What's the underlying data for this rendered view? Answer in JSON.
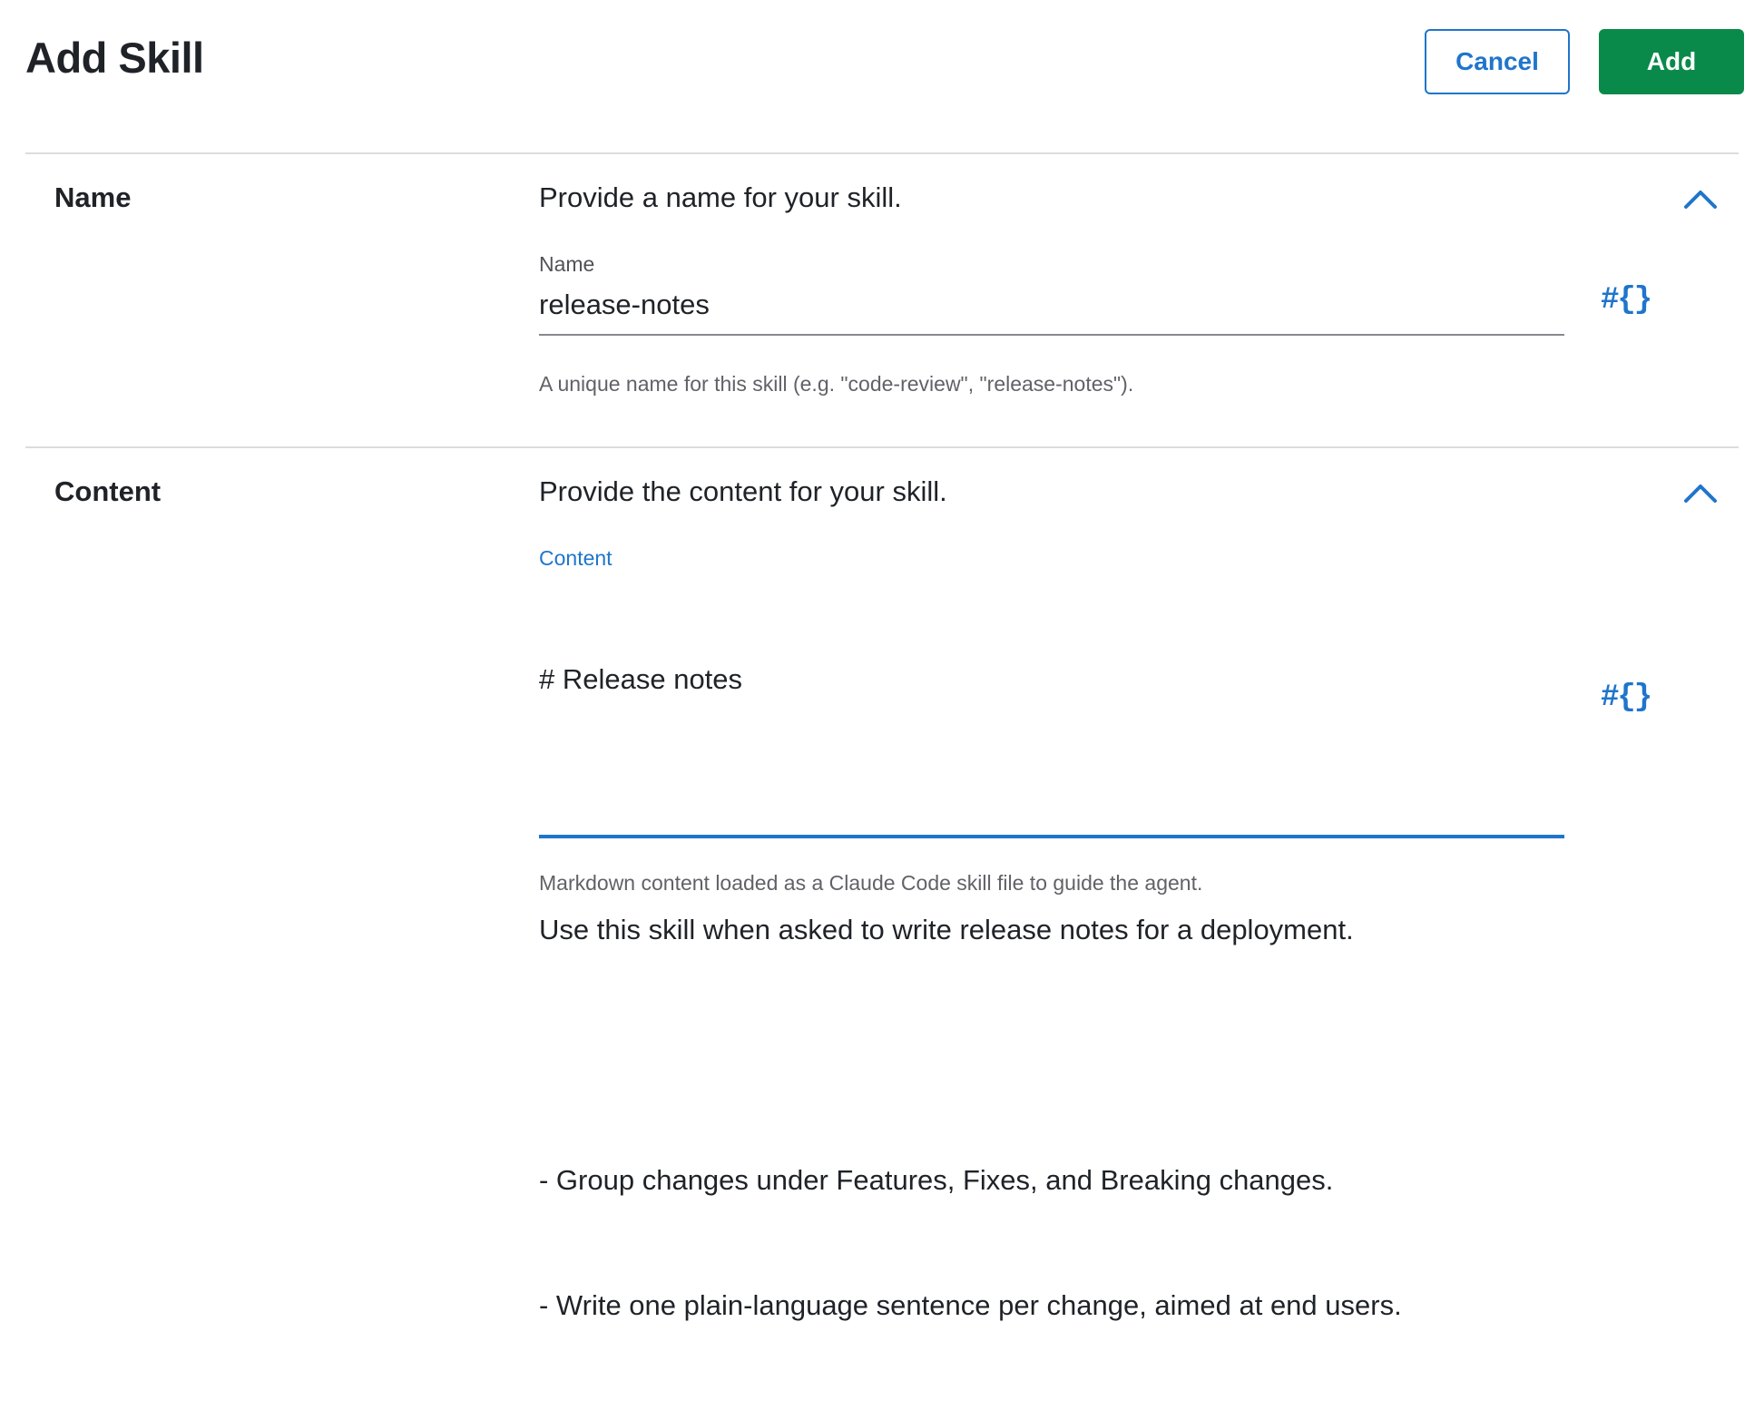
{
  "header": {
    "title": "Add Skill",
    "cancel_label": "Cancel",
    "add_label": "Add"
  },
  "colors": {
    "accent": "#1f75cb",
    "primary_button": "#0a8a4a",
    "divider": "#dcdcde"
  },
  "name_section": {
    "label": "Name",
    "description": "Provide a name for your skill.",
    "field_label": "Name",
    "value": "release-notes",
    "hint": "A unique name for this skill (e.g. \"code-review\", \"release-notes\").",
    "variable_icon": "#{}",
    "collapse_icon": "chevron-up-icon"
  },
  "content_section": {
    "label": "Content",
    "description": "Provide the content for your skill.",
    "field_label": "Content",
    "lines": [
      "# Release notes",
      "",
      "Use this skill when asked to write release notes for a deployment.",
      "",
      "- Group changes under Features, Fixes, and Breaking changes.",
      "- Write one plain-language sentence per change, aimed at end users."
    ],
    "hint": "Markdown content loaded as a Claude Code skill file to guide the agent.",
    "variable_icon": "#{}",
    "collapse_icon": "chevron-up-icon"
  }
}
